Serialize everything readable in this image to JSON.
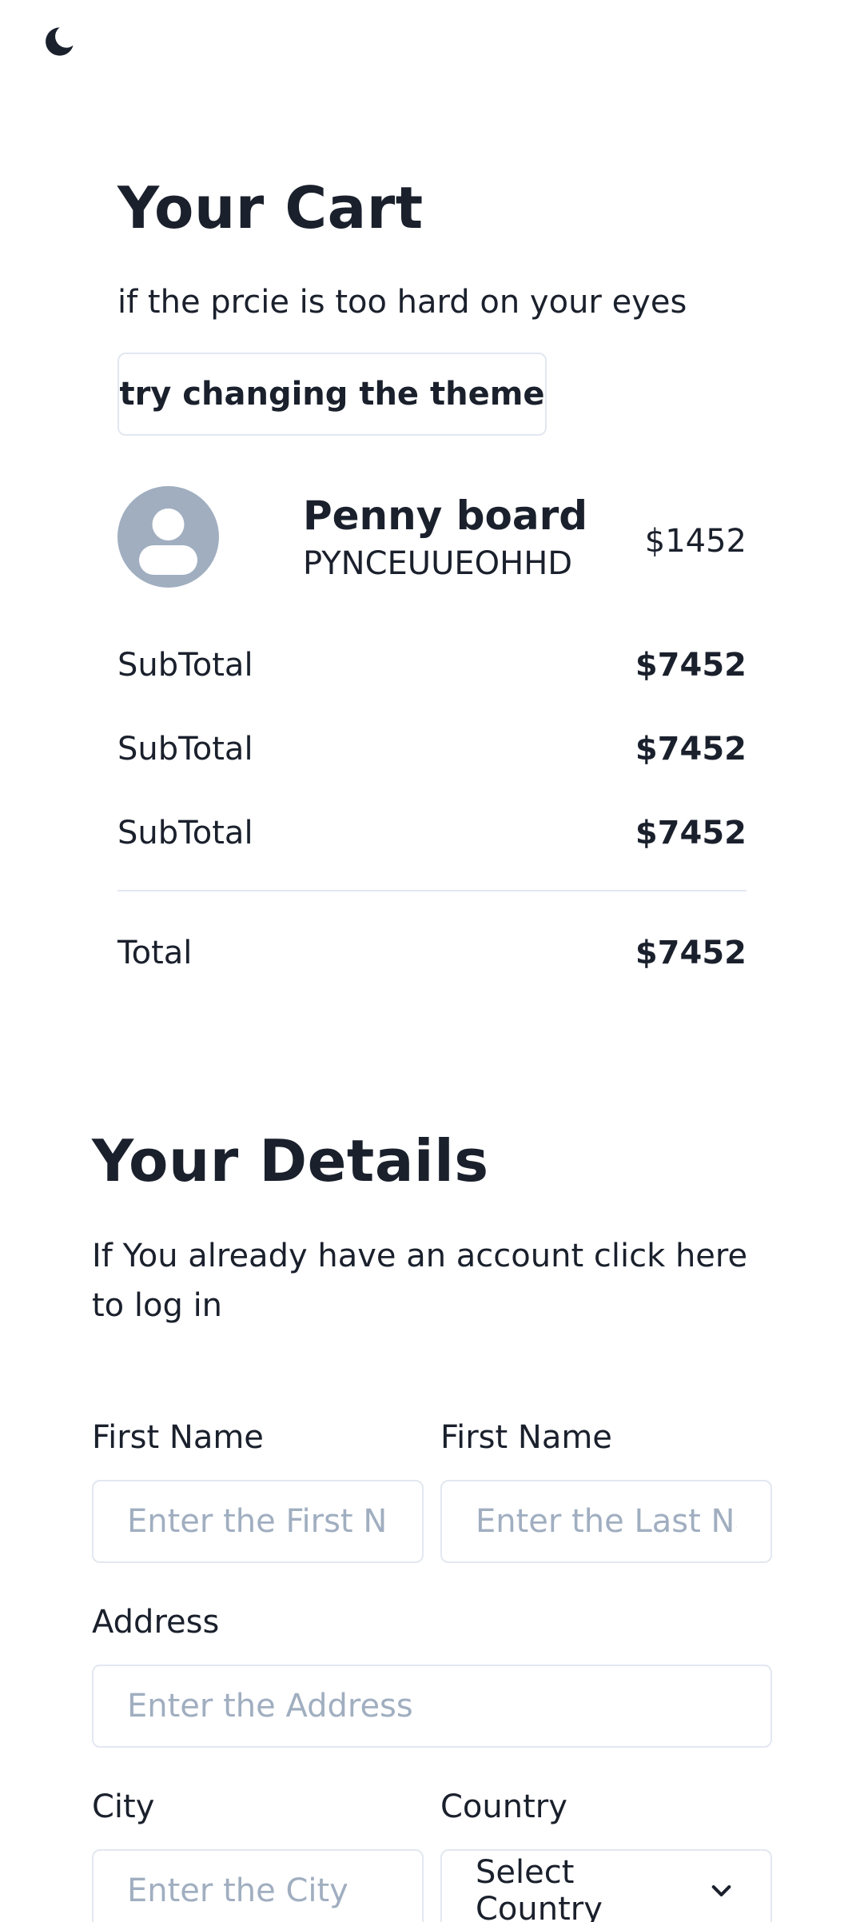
{
  "theme_toggle": {
    "icon": "moon-icon"
  },
  "cart": {
    "title": "Your Cart",
    "subtitle": "if the prcie is too hard on your eyes",
    "theme_button_label": "try changing the theme",
    "item": {
      "avatar_icon": "user-avatar-icon",
      "name": "Penny board",
      "code": "PYNCEUUEOHHD",
      "price": "$1452"
    },
    "summary": [
      {
        "label": "SubTotal",
        "value": "$7452"
      },
      {
        "label": "SubTotal",
        "value": "$7452"
      },
      {
        "label": "SubTotal",
        "value": "$7452"
      }
    ],
    "total": {
      "label": "Total",
      "value": "$7452"
    }
  },
  "details": {
    "title": "Your Details",
    "subtitle": "If You already have an account click here to log in",
    "first_name": {
      "label": "First Name",
      "placeholder": "Enter the First Name"
    },
    "last_name": {
      "label": "First Name",
      "placeholder": "Enter the Last Name"
    },
    "address": {
      "label": "Address",
      "placeholder": "Enter the Address"
    },
    "city": {
      "label": "City",
      "placeholder": "Enter the City"
    },
    "country": {
      "label": "Country",
      "selected": "Select Country",
      "icon": "chevron-down-icon"
    }
  },
  "colors": {
    "text": "#1a202c",
    "border": "#e2e8f0",
    "placeholder": "#a0aec0",
    "avatar_bg": "#a0aec0"
  }
}
